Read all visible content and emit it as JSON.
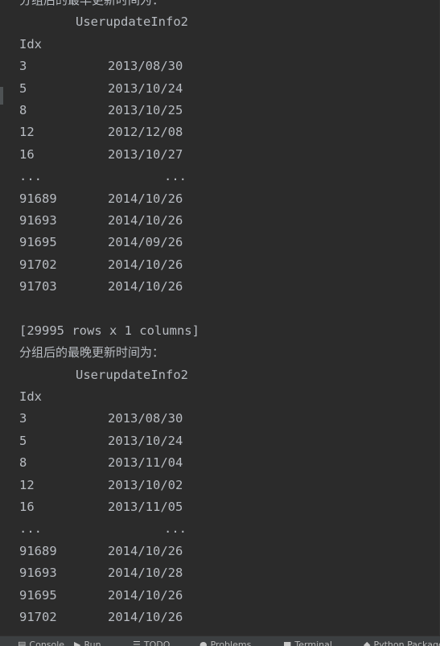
{
  "console": {
    "lines": [
      {
        "kind": "cjk",
        "text": "分组后的最早更新时间为："
      },
      {
        "kind": "header",
        "text": "UserupdateInfo2"
      },
      {
        "kind": "plain",
        "text": "Idx"
      },
      {
        "kind": "row",
        "idx": "3",
        "val": "2013/08/30"
      },
      {
        "kind": "row",
        "idx": "5",
        "val": "2013/10/24"
      },
      {
        "kind": "row",
        "idx": "8",
        "val": "2013/10/25"
      },
      {
        "kind": "row",
        "idx": "12",
        "val": "2012/12/08"
      },
      {
        "kind": "row",
        "idx": "16",
        "val": "2013/10/27"
      },
      {
        "kind": "ellipsis",
        "idx": "...",
        "val": "..."
      },
      {
        "kind": "row",
        "idx": "91689",
        "val": "2014/10/26"
      },
      {
        "kind": "row",
        "idx": "91693",
        "val": "2014/10/26"
      },
      {
        "kind": "row",
        "idx": "91695",
        "val": "2014/09/26"
      },
      {
        "kind": "row",
        "idx": "91702",
        "val": "2014/10/26"
      },
      {
        "kind": "row",
        "idx": "91703",
        "val": "2014/10/26"
      },
      {
        "kind": "blank",
        "text": ""
      },
      {
        "kind": "plain",
        "text": "[29995 rows x 1 columns]"
      },
      {
        "kind": "cjk",
        "text": "分组后的最晚更新时间为："
      },
      {
        "kind": "header",
        "text": "UserupdateInfo2"
      },
      {
        "kind": "plain",
        "text": "Idx"
      },
      {
        "kind": "row",
        "idx": "3",
        "val": "2013/08/30"
      },
      {
        "kind": "row",
        "idx": "5",
        "val": "2013/10/24"
      },
      {
        "kind": "row",
        "idx": "8",
        "val": "2013/11/04"
      },
      {
        "kind": "row",
        "idx": "12",
        "val": "2013/10/02"
      },
      {
        "kind": "row",
        "idx": "16",
        "val": "2013/11/05"
      },
      {
        "kind": "ellipsis",
        "idx": "...",
        "val": "..."
      },
      {
        "kind": "row",
        "idx": "91689",
        "val": "2014/10/26"
      },
      {
        "kind": "row",
        "idx": "91693",
        "val": "2014/10/28"
      },
      {
        "kind": "row",
        "idx": "91695",
        "val": "2014/10/26"
      },
      {
        "kind": "row",
        "idx": "91702",
        "val": "2014/10/26"
      }
    ]
  },
  "toolbar": {
    "items": [
      {
        "name": "console-tab",
        "icon": "console-icon",
        "glyph": "▤",
        "label": "Console"
      },
      {
        "name": "run-tab",
        "icon": "run-icon",
        "glyph": "▶",
        "label": "Run"
      },
      {
        "name": "todo-tab",
        "icon": "list-icon",
        "glyph": "☰",
        "label": "TODO"
      },
      {
        "name": "problems-tab",
        "icon": "problems-icon",
        "glyph": "●",
        "label": "Problems"
      },
      {
        "name": "terminal-tab",
        "icon": "terminal-icon",
        "glyph": "■",
        "label": "Terminal"
      },
      {
        "name": "python-packages-tab",
        "icon": "package-icon",
        "glyph": "◆",
        "label": "Python Packages"
      }
    ]
  }
}
